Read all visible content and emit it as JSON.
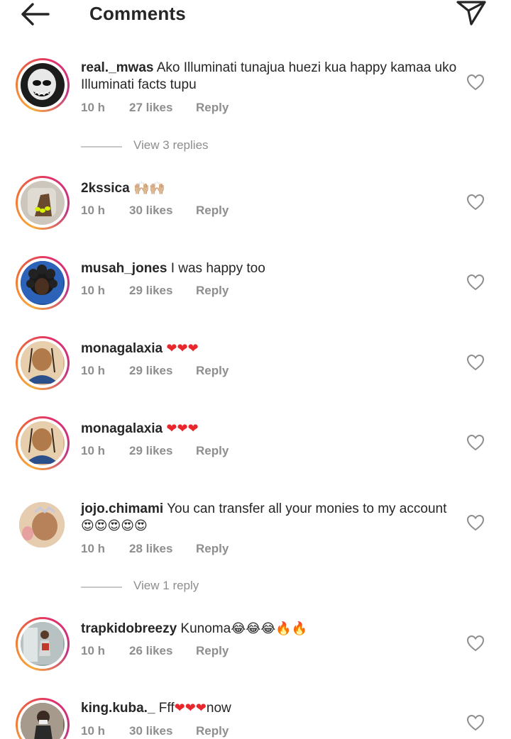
{
  "header": {
    "title": "Comments",
    "back_icon": "arrow-left-icon",
    "send_icon": "paper-plane-icon"
  },
  "colors": {
    "text": "#262626",
    "meta": "#8e8e8e",
    "heart_red": "#e8262c",
    "story_ring": [
      "#f9a83a",
      "#e1306c",
      "#c13584"
    ]
  },
  "comments": [
    {
      "user": "real._mwas",
      "text": " Ako Illuminati tunajua huezi kua happy kamaa uko Illuminati facts tupu",
      "emoji": "",
      "time": "10 h",
      "likes": "27 likes",
      "reply": "Reply",
      "view_replies": "View 3 replies"
    },
    {
      "user": "2kssica",
      "text": " ",
      "emoji": "🙌🏼🙌🏼",
      "time": "10 h",
      "likes": "30 likes",
      "reply": "Reply"
    },
    {
      "user": "musah_jones",
      "text": " I was happy too",
      "emoji": "",
      "time": "10 h",
      "likes": "29 likes",
      "reply": "Reply"
    },
    {
      "user": "monagalaxia",
      "text": " ",
      "emoji": "❤❤❤",
      "time": "10 h",
      "likes": "29 likes",
      "reply": "Reply"
    },
    {
      "user": "monagalaxia",
      "text": " ",
      "emoji": "❤❤❤",
      "time": "10 h",
      "likes": "29 likes",
      "reply": "Reply"
    },
    {
      "user": "jojo.chimami",
      "text": " You can transfer all your monies to my account ",
      "emoji": "😍😍😍😍😍",
      "time": "10 h",
      "likes": "28 likes",
      "reply": "Reply",
      "view_replies": "View 1 reply"
    },
    {
      "user": "trapkidobreezy",
      "text": " Kunoma",
      "emoji": "😂😂😂🔥🔥",
      "time": "10 h",
      "likes": "26 likes",
      "reply": "Reply"
    },
    {
      "user": "king.kuba._",
      "text": " Fff",
      "emoji": "❤❤❤",
      "text_after": "now",
      "time": "10 h",
      "likes": "30 likes",
      "reply": "Reply"
    }
  ]
}
